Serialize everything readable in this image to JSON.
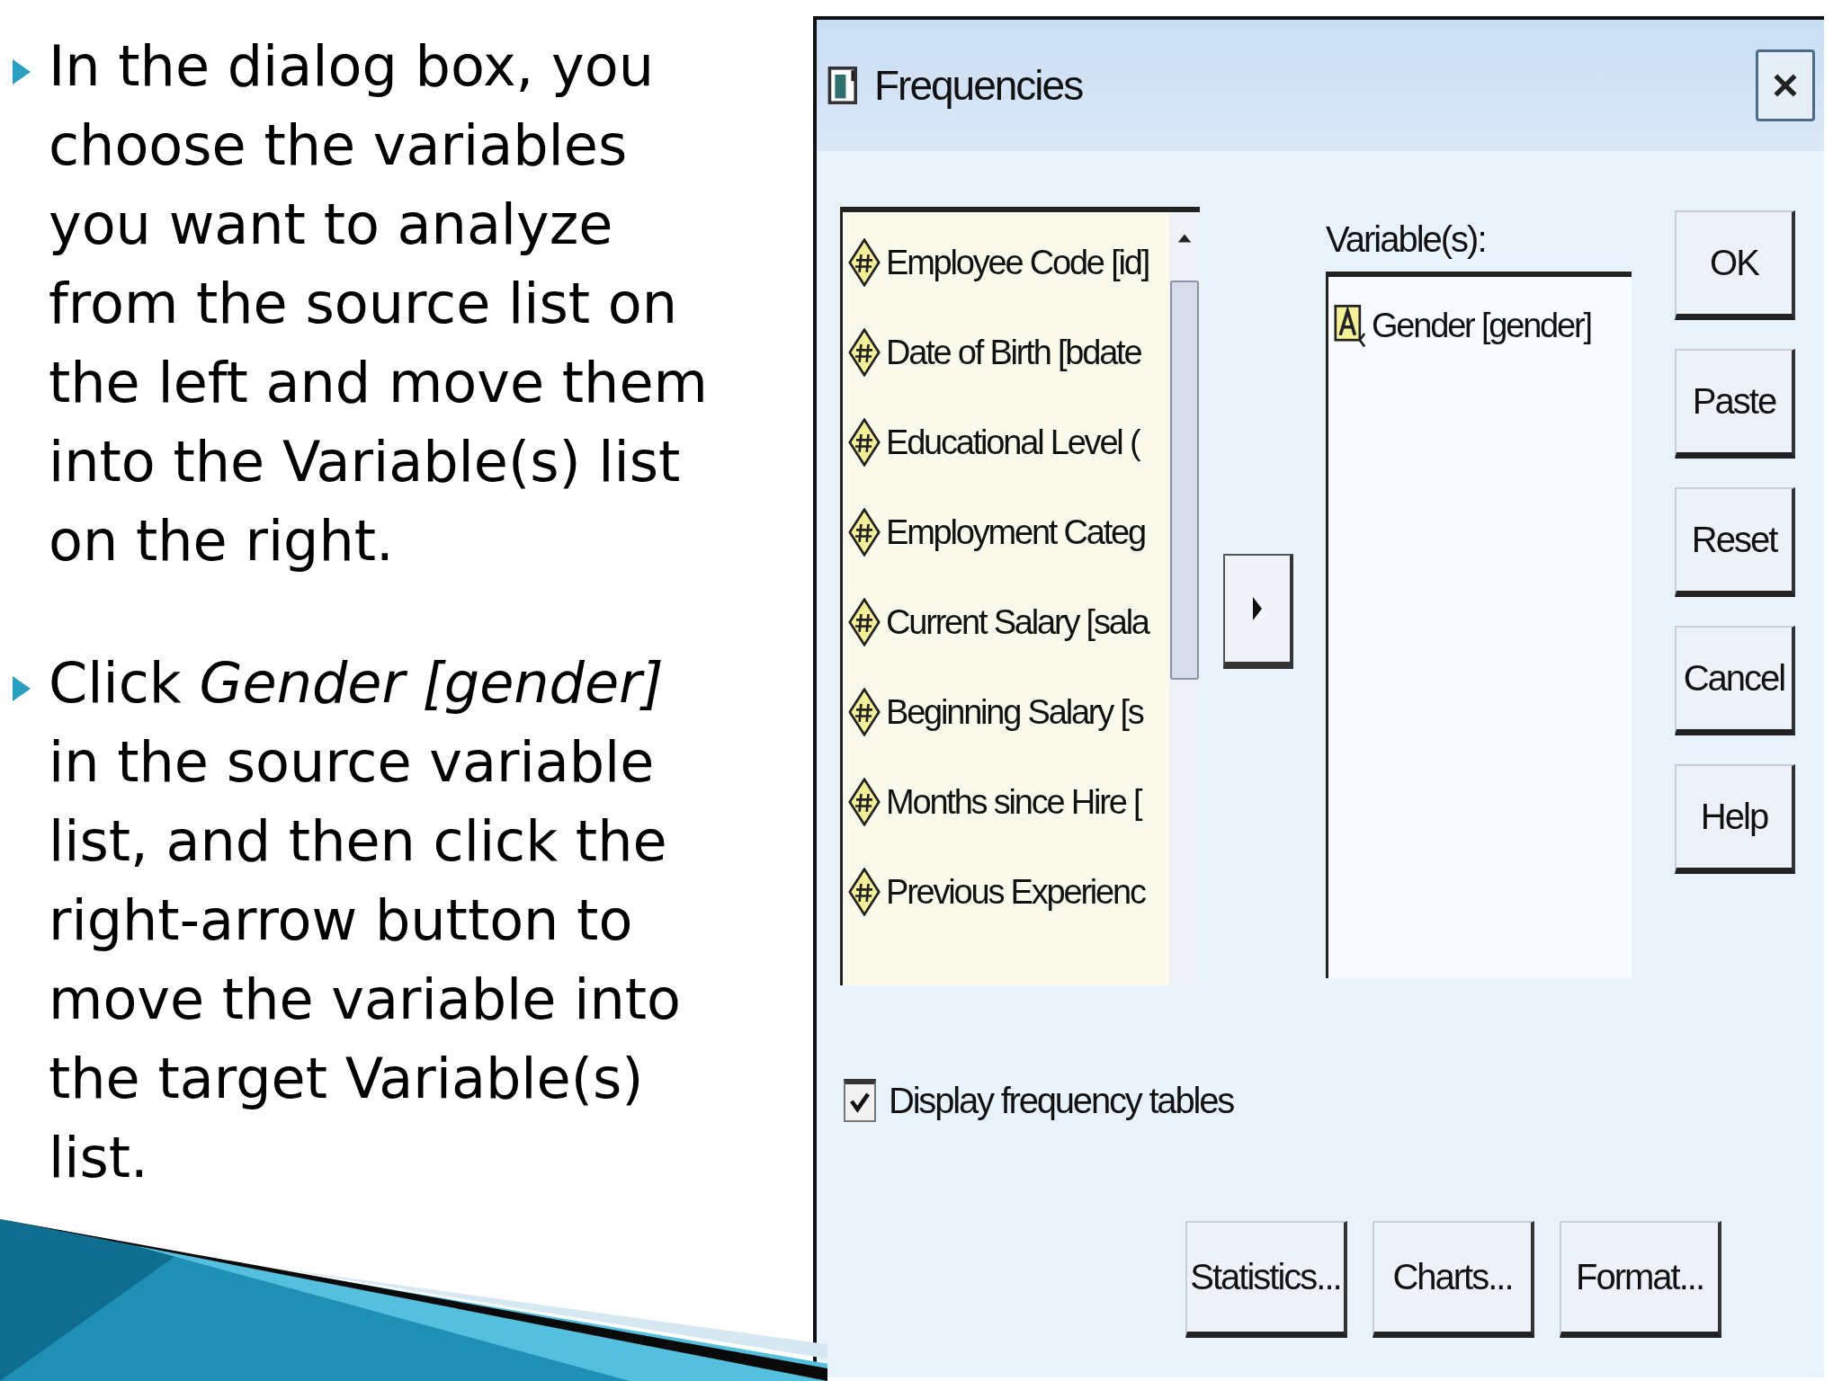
{
  "slide": {
    "paragraphs": [
      "In the dialog box, you\nchoose the variables\nyou want to analyze\nfrom the source list on\nthe left and move them\ninto the Variable(s) list\non the right.",
      "Click *Gender [gender]*\nin the source variable\nlist, and then click the\nright-arrow button to\nmove the variable into\nthe target Variable(s)\nlist."
    ]
  },
  "dialog": {
    "title": "Frequencies",
    "source_variables": [
      {
        "label": "Employee Code [id]",
        "kind": "scale"
      },
      {
        "label": "Date of Birth [bdate",
        "kind": "scale"
      },
      {
        "label": "Educational Level (",
        "kind": "scale"
      },
      {
        "label": "Employment Categ",
        "kind": "scale"
      },
      {
        "label": "Current Salary [sala",
        "kind": "scale"
      },
      {
        "label": "Beginning Salary [s",
        "kind": "scale"
      },
      {
        "label": "Months since Hire [",
        "kind": "scale"
      },
      {
        "label": "Previous Experienc",
        "kind": "scale"
      }
    ],
    "target_label": "Variable(s):",
    "target_variables": [
      {
        "label": "Gender [gender]",
        "kind": "nominal"
      }
    ],
    "side_buttons": [
      "OK",
      "Paste",
      "Reset",
      "Cancel",
      "Help"
    ],
    "checkbox": {
      "label": "Display frequency tables",
      "checked": true
    },
    "bottom_buttons": [
      "Statistics...",
      "Charts...",
      "Format..."
    ]
  }
}
